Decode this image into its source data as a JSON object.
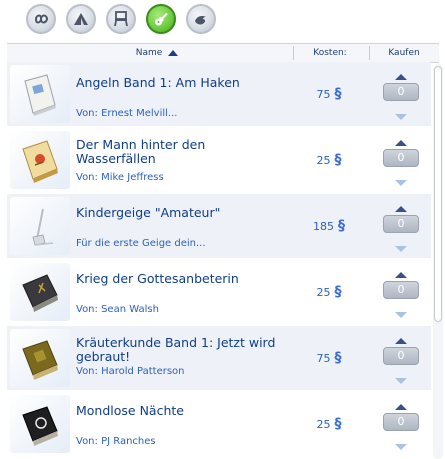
{
  "tabs": [
    {
      "name": "all-tab",
      "icon": "infinity-icon",
      "active": false
    },
    {
      "name": "outdoor-tab",
      "icon": "tent-icon",
      "active": false
    },
    {
      "name": "furniture-tab",
      "icon": "chair-icon",
      "active": false
    },
    {
      "name": "hobby-tab",
      "icon": "guitar-icon",
      "active": true
    },
    {
      "name": "nature-tab",
      "icon": "bird-icon",
      "active": false
    }
  ],
  "header": {
    "name_label": "Name",
    "cost_label": "Kosten:",
    "buy_label": "Kaufen"
  },
  "items": [
    {
      "title": "Angeln Band 1: Am Haken",
      "subtitle": "Von: Ernest Melvill...",
      "price": "75",
      "qty": "0",
      "icon": "book-fishing-icon"
    },
    {
      "title": "Der Mann hinter den Wasserfällen",
      "subtitle": "Von: Mike Jeffress",
      "price": "25",
      "qty": "0",
      "icon": "book-waterfall-icon"
    },
    {
      "title": "Kindergeige \"Amateur\"",
      "subtitle": "Für die erste Geige dein...",
      "price": "185",
      "qty": "0",
      "icon": "violin-icon"
    },
    {
      "title": "Krieg der Gottesanbeterin",
      "subtitle": "Von: Sean Walsh",
      "price": "25",
      "qty": "0",
      "icon": "book-dark-icon"
    },
    {
      "title": "Kräuterkunde Band 1: Jetzt wird gebraut!",
      "subtitle": "Von: Harold Patterson",
      "price": "75",
      "qty": "0",
      "icon": "book-herbs-icon"
    },
    {
      "title": "Mondlose Nächte",
      "subtitle": "Von: PJ Ranches",
      "price": "25",
      "qty": "0",
      "icon": "book-moonless-icon"
    }
  ],
  "currency_symbol": "§"
}
